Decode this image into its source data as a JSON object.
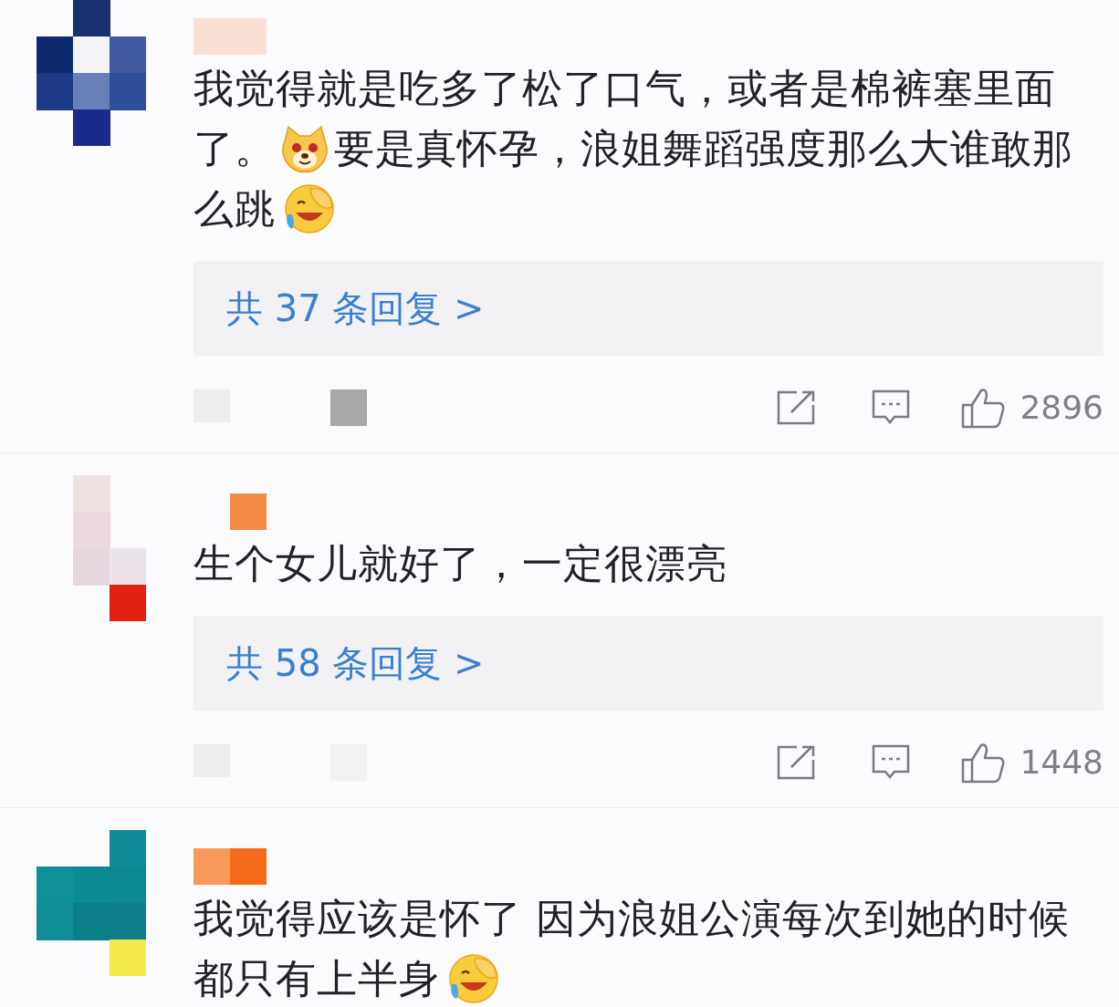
{
  "comments": [
    {
      "lines": [
        [
          {
            "kind": "text",
            "text": "我觉得就是吃多了松了口气，或者是棉裤塞里面"
          }
        ],
        [
          {
            "kind": "text",
            "text": "了。"
          },
          {
            "kind": "dog"
          },
          {
            "kind": "text",
            "text": "要是真怀孕，浪姐舞蹈强度那么大谁敢那"
          }
        ],
        [
          {
            "kind": "text",
            "text": "么跳"
          },
          {
            "kind": "laugh"
          }
        ]
      ],
      "replies": "共 37 条回复 >",
      "likes": "2896"
    },
    {
      "lines": [
        [
          {
            "kind": "text",
            "text": "生个女儿就好了，一定很漂亮"
          }
        ]
      ],
      "replies": "共 58 条回复 >",
      "likes": "1448"
    },
    {
      "lines": [
        [
          {
            "kind": "text",
            "text": "我觉得应该是怀了 因为浪姐公演每次到她的时候"
          }
        ],
        [
          {
            "kind": "text",
            "text": "都只有上半身"
          },
          {
            "kind": "laugh"
          }
        ]
      ]
    }
  ]
}
